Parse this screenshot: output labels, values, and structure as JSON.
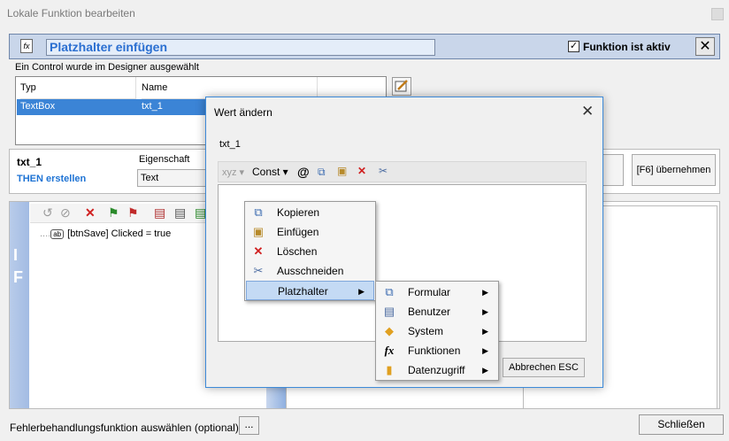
{
  "window": {
    "title": "Lokale Funktion bearbeiten"
  },
  "header": {
    "field_value": "Platzhalter einfügen",
    "active_label": "Funktion ist aktiv",
    "active_checked": "✓",
    "close": "✕"
  },
  "selection": {
    "label": "Ein Control wurde im Designer ausgewählt",
    "columns": [
      "Typ",
      "Name"
    ],
    "rows": [
      {
        "typ": "TextBox",
        "name": "txt_1"
      }
    ]
  },
  "property": {
    "name": "txt_1",
    "then": "THEN erstellen",
    "eig_label": "Eigenschaft",
    "eig_value": "Text",
    "apply_button": "[F6] übernehmen"
  },
  "if_panel": {
    "letters": [
      "I",
      "F"
    ],
    "tree_item_icon": "ab",
    "tree_item": "[btnSave] Clicked = true"
  },
  "footer": {
    "error_label": "Fehlerbehandlungsfunktion auswählen (optional)",
    "dots": "...",
    "close": "Schließen"
  },
  "dialog": {
    "title": "Wert ändern",
    "caption": "txt_1",
    "toolbar": {
      "xyz": "xyz ▾",
      "const": "Const ▾",
      "at": "@"
    },
    "cancel": "Abbrechen  ESC"
  },
  "context_menu": [
    {
      "label": "Kopieren",
      "icon": "copy-icon"
    },
    {
      "label": "Einfügen",
      "icon": "paste-icon"
    },
    {
      "label": "Löschen",
      "icon": "delete-icon"
    },
    {
      "label": "Ausschneiden",
      "icon": "cut-icon"
    },
    {
      "label": "Platzhalter",
      "icon": "",
      "highlighted": true
    }
  ],
  "submenu": [
    {
      "label": "Formular",
      "icon": "form-icon"
    },
    {
      "label": "Benutzer",
      "icon": "user-card-icon"
    },
    {
      "label": "System",
      "icon": "tag-icon"
    },
    {
      "label": "Funktionen",
      "icon": "function-icon"
    },
    {
      "label": "Datenzugriff",
      "icon": "database-icon"
    }
  ]
}
